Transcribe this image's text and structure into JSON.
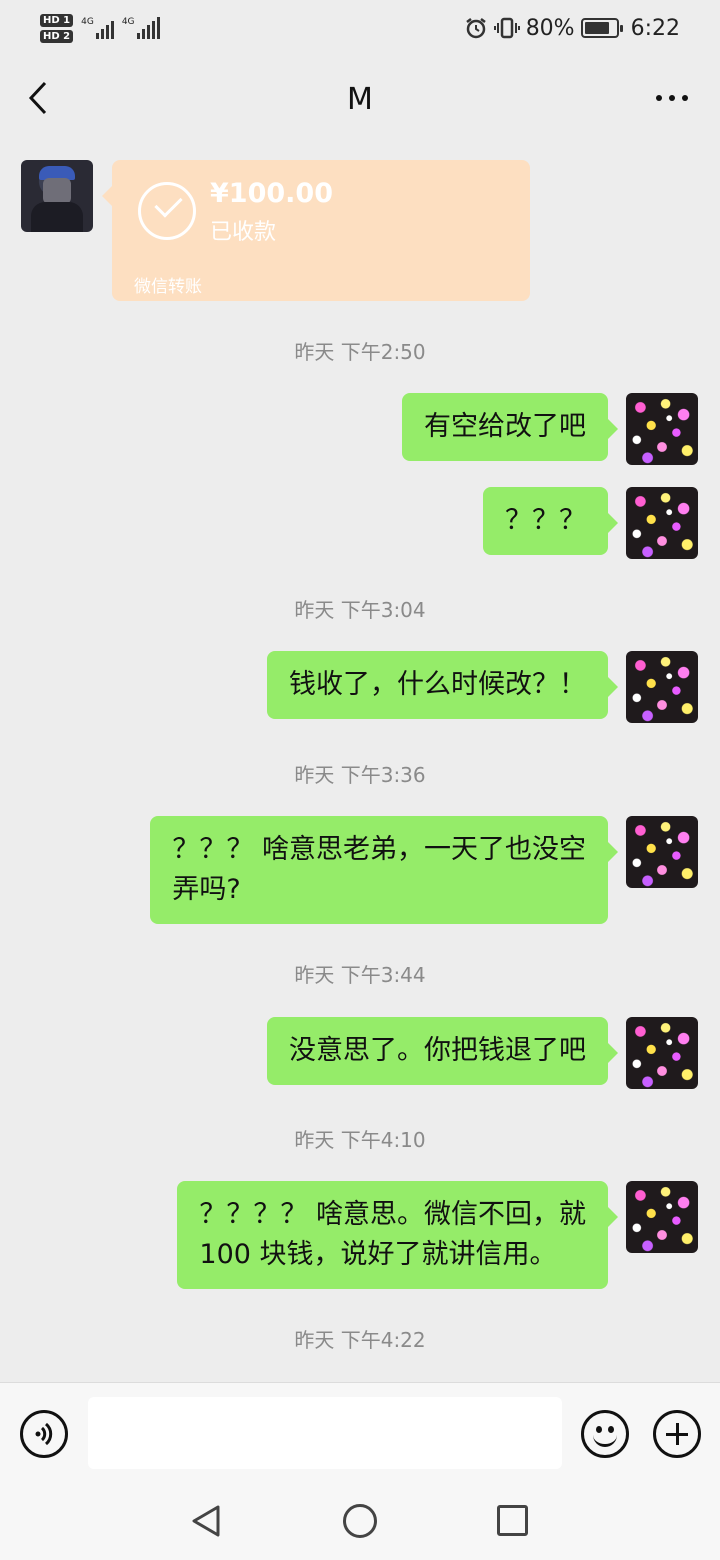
{
  "status_bar": {
    "hd1": "HD 1",
    "hd2": "HD 2",
    "net1": "4G",
    "net2": "4G",
    "battery_text": "80%",
    "battery_level": 0.8,
    "time": "6:22",
    "icons": [
      "alarm-icon",
      "vibrate-icon",
      "battery-icon",
      "signal-icon"
    ]
  },
  "header": {
    "title": "M"
  },
  "transfer": {
    "amount": "¥100.00",
    "status": "已收款",
    "label": "微信转账",
    "color": "#fddfc1"
  },
  "timestamps": [
    "昨天 下午2:50",
    "昨天 下午3:04",
    "昨天 下午3:36",
    "昨天 下午3:44",
    "昨天 下午4:10",
    "昨天 下午4:22"
  ],
  "messages": [
    "有空给改了吧",
    "？？？",
    "钱收了，什么时候改？！",
    "？？？ 啥意思老弟，一天了也没空\n弄吗?",
    "没意思了。你把钱退了吧",
    "？？？？ 啥意思。微信不回，就\n100 块钱，说好了就讲信用。"
  ],
  "colors": {
    "background": "#ededed",
    "bubble_sent": "#95ec69",
    "timestamp": "#8a8a8a"
  },
  "input": {
    "placeholder": ""
  }
}
